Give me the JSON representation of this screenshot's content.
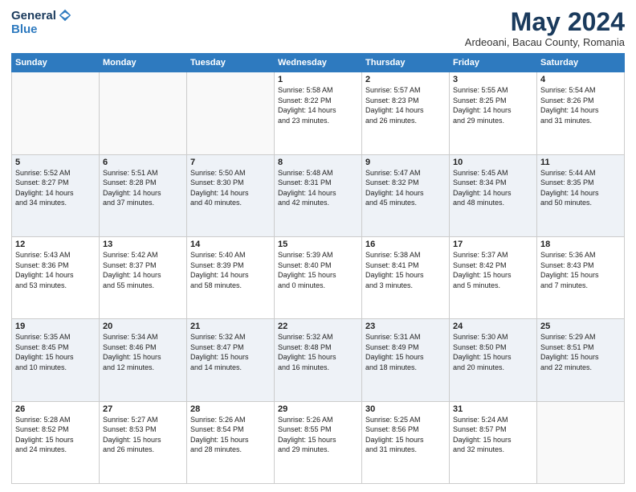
{
  "header": {
    "logo_general": "General",
    "logo_blue": "Blue",
    "month_title": "May 2024",
    "location": "Ardeoani, Bacau County, Romania"
  },
  "days_of_week": [
    "Sunday",
    "Monday",
    "Tuesday",
    "Wednesday",
    "Thursday",
    "Friday",
    "Saturday"
  ],
  "weeks": [
    [
      {
        "num": "",
        "info": ""
      },
      {
        "num": "",
        "info": ""
      },
      {
        "num": "",
        "info": ""
      },
      {
        "num": "1",
        "info": "Sunrise: 5:58 AM\nSunset: 8:22 PM\nDaylight: 14 hours\nand 23 minutes."
      },
      {
        "num": "2",
        "info": "Sunrise: 5:57 AM\nSunset: 8:23 PM\nDaylight: 14 hours\nand 26 minutes."
      },
      {
        "num": "3",
        "info": "Sunrise: 5:55 AM\nSunset: 8:25 PM\nDaylight: 14 hours\nand 29 minutes."
      },
      {
        "num": "4",
        "info": "Sunrise: 5:54 AM\nSunset: 8:26 PM\nDaylight: 14 hours\nand 31 minutes."
      }
    ],
    [
      {
        "num": "5",
        "info": "Sunrise: 5:52 AM\nSunset: 8:27 PM\nDaylight: 14 hours\nand 34 minutes."
      },
      {
        "num": "6",
        "info": "Sunrise: 5:51 AM\nSunset: 8:28 PM\nDaylight: 14 hours\nand 37 minutes."
      },
      {
        "num": "7",
        "info": "Sunrise: 5:50 AM\nSunset: 8:30 PM\nDaylight: 14 hours\nand 40 minutes."
      },
      {
        "num": "8",
        "info": "Sunrise: 5:48 AM\nSunset: 8:31 PM\nDaylight: 14 hours\nand 42 minutes."
      },
      {
        "num": "9",
        "info": "Sunrise: 5:47 AM\nSunset: 8:32 PM\nDaylight: 14 hours\nand 45 minutes."
      },
      {
        "num": "10",
        "info": "Sunrise: 5:45 AM\nSunset: 8:34 PM\nDaylight: 14 hours\nand 48 minutes."
      },
      {
        "num": "11",
        "info": "Sunrise: 5:44 AM\nSunset: 8:35 PM\nDaylight: 14 hours\nand 50 minutes."
      }
    ],
    [
      {
        "num": "12",
        "info": "Sunrise: 5:43 AM\nSunset: 8:36 PM\nDaylight: 14 hours\nand 53 minutes."
      },
      {
        "num": "13",
        "info": "Sunrise: 5:42 AM\nSunset: 8:37 PM\nDaylight: 14 hours\nand 55 minutes."
      },
      {
        "num": "14",
        "info": "Sunrise: 5:40 AM\nSunset: 8:39 PM\nDaylight: 14 hours\nand 58 minutes."
      },
      {
        "num": "15",
        "info": "Sunrise: 5:39 AM\nSunset: 8:40 PM\nDaylight: 15 hours\nand 0 minutes."
      },
      {
        "num": "16",
        "info": "Sunrise: 5:38 AM\nSunset: 8:41 PM\nDaylight: 15 hours\nand 3 minutes."
      },
      {
        "num": "17",
        "info": "Sunrise: 5:37 AM\nSunset: 8:42 PM\nDaylight: 15 hours\nand 5 minutes."
      },
      {
        "num": "18",
        "info": "Sunrise: 5:36 AM\nSunset: 8:43 PM\nDaylight: 15 hours\nand 7 minutes."
      }
    ],
    [
      {
        "num": "19",
        "info": "Sunrise: 5:35 AM\nSunset: 8:45 PM\nDaylight: 15 hours\nand 10 minutes."
      },
      {
        "num": "20",
        "info": "Sunrise: 5:34 AM\nSunset: 8:46 PM\nDaylight: 15 hours\nand 12 minutes."
      },
      {
        "num": "21",
        "info": "Sunrise: 5:32 AM\nSunset: 8:47 PM\nDaylight: 15 hours\nand 14 minutes."
      },
      {
        "num": "22",
        "info": "Sunrise: 5:32 AM\nSunset: 8:48 PM\nDaylight: 15 hours\nand 16 minutes."
      },
      {
        "num": "23",
        "info": "Sunrise: 5:31 AM\nSunset: 8:49 PM\nDaylight: 15 hours\nand 18 minutes."
      },
      {
        "num": "24",
        "info": "Sunrise: 5:30 AM\nSunset: 8:50 PM\nDaylight: 15 hours\nand 20 minutes."
      },
      {
        "num": "25",
        "info": "Sunrise: 5:29 AM\nSunset: 8:51 PM\nDaylight: 15 hours\nand 22 minutes."
      }
    ],
    [
      {
        "num": "26",
        "info": "Sunrise: 5:28 AM\nSunset: 8:52 PM\nDaylight: 15 hours\nand 24 minutes."
      },
      {
        "num": "27",
        "info": "Sunrise: 5:27 AM\nSunset: 8:53 PM\nDaylight: 15 hours\nand 26 minutes."
      },
      {
        "num": "28",
        "info": "Sunrise: 5:26 AM\nSunset: 8:54 PM\nDaylight: 15 hours\nand 28 minutes."
      },
      {
        "num": "29",
        "info": "Sunrise: 5:26 AM\nSunset: 8:55 PM\nDaylight: 15 hours\nand 29 minutes."
      },
      {
        "num": "30",
        "info": "Sunrise: 5:25 AM\nSunset: 8:56 PM\nDaylight: 15 hours\nand 31 minutes."
      },
      {
        "num": "31",
        "info": "Sunrise: 5:24 AM\nSunset: 8:57 PM\nDaylight: 15 hours\nand 32 minutes."
      },
      {
        "num": "",
        "info": ""
      }
    ]
  ]
}
